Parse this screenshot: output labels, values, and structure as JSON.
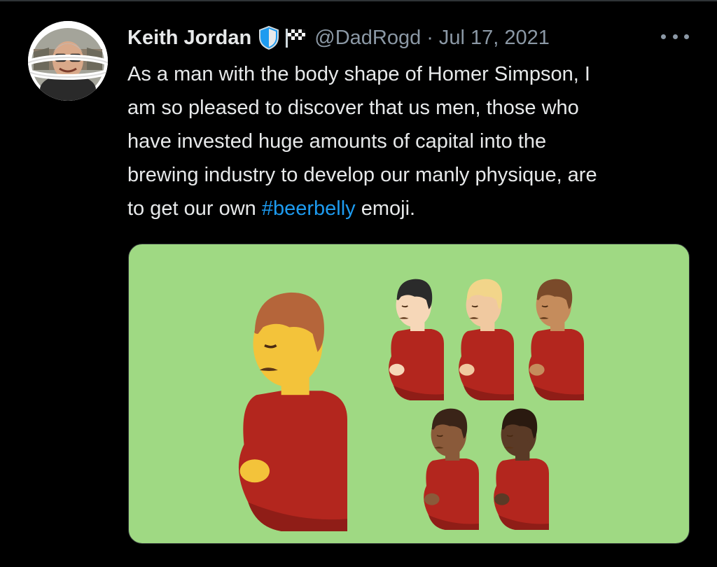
{
  "tweet": {
    "author_name": "Keith Jordan",
    "handle": "@DadRogd",
    "separator": "·",
    "date": "Jul 17, 2021",
    "text_lines": [
      "As a man with the body shape of Homer Simpson, I",
      "am so pleased to discover that us men, those who",
      "have invested huge amounts of capital into the",
      "brewing industry to develop our manly physique, are"
    ],
    "last_line_prefix": "to get our own ",
    "hashtag": "#beerbelly",
    "last_line_suffix": " emoji."
  },
  "icons": {
    "badge": "verified-shield-icon",
    "flag": "chequered-flag-icon",
    "more": "more-options-icon"
  },
  "media": {
    "description_colors": {
      "background": "#9fd983",
      "shirt": "#b3261e",
      "skin_tones": [
        "#f3c33a",
        "#f6d7b8",
        "#f0c9a0",
        "#c58c5c",
        "#8a5a3a",
        "#5a3a26"
      ]
    }
  },
  "colors": {
    "background": "#000000",
    "text": "#e7e9ea",
    "muted": "#8b98a5",
    "link": "#1d9bf0"
  }
}
